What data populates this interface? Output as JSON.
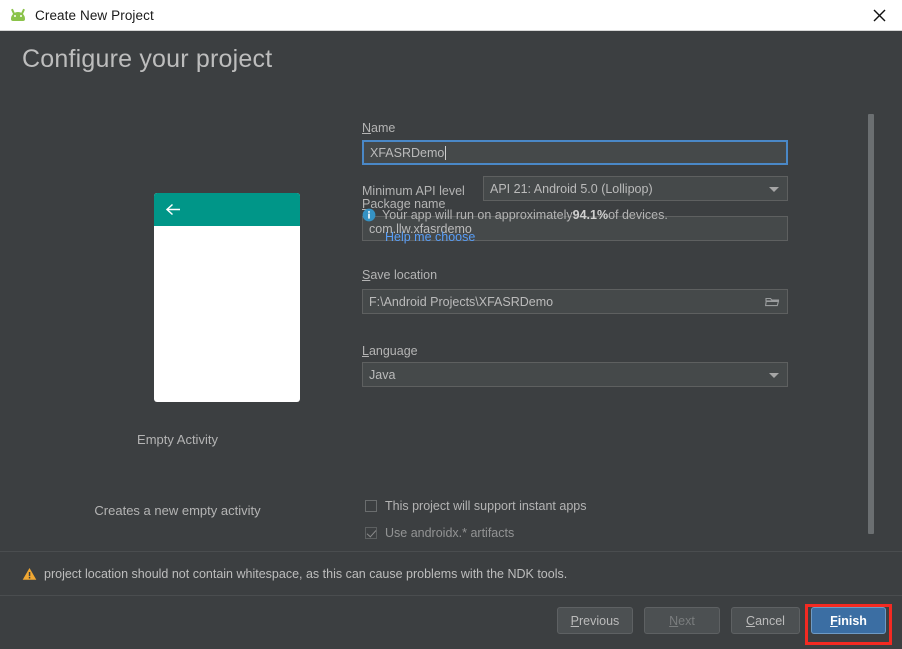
{
  "window": {
    "title": "Create New Project",
    "app_icon": "android-robot-icon",
    "close_icon": "close-icon"
  },
  "heading": "Configure your project",
  "preview": {
    "template_title": "Empty Activity",
    "template_description": "Creates a new empty activity",
    "appbar_color": "#009688",
    "back_icon": "arrow-left-icon"
  },
  "form": {
    "name": {
      "label": "Name",
      "mnemonic": "N",
      "value": "XFASRDemo",
      "focused": true
    },
    "package_name": {
      "label": "Package name",
      "mnemonic": "P",
      "value": "com.llw.xfasrdemo"
    },
    "save_location": {
      "label": "Save location",
      "mnemonic": "S",
      "value": "F:\\Android Projects\\XFASRDemo",
      "browse_icon": "folder-icon"
    },
    "language": {
      "label": "Language",
      "mnemonic": "L",
      "value": "Java",
      "dropdown_icon": "chevron-down-icon"
    },
    "min_api": {
      "label": "Minimum API level",
      "value": "API 21: Android 5.0 (Lollipop)",
      "dropdown_icon": "chevron-down-icon"
    },
    "device_info": {
      "icon": "info-icon",
      "prefix": "Your app will run on approximately ",
      "percent": "94.1%",
      "suffix": " of devices.",
      "link": "Help me choose",
      "link_color": "#589df6"
    },
    "checkboxes": [
      {
        "label": "This project will support instant apps",
        "checked": false
      },
      {
        "label": "Use androidx.* artifacts",
        "checked": true
      }
    ]
  },
  "warning": {
    "icon": "warning-triangle-icon",
    "text": "project location should not contain whitespace, as this can cause problems with the NDK tools.",
    "icon_color": "#f0a732"
  },
  "buttons": {
    "previous": {
      "label_before": "",
      "mnemonic": "P",
      "label_after": "revious",
      "enabled": true
    },
    "next": {
      "label_before": "",
      "mnemonic": "N",
      "label_after": "ext",
      "enabled": false
    },
    "cancel": {
      "label_before": "",
      "mnemonic": "C",
      "label_after": "ancel",
      "enabled": true
    },
    "finish": {
      "label_before": "",
      "mnemonic": "F",
      "label_after": "inish",
      "enabled": true,
      "primary": true
    }
  },
  "annotation": {
    "highlight_color": "#f42a22",
    "target": "finish-button"
  }
}
